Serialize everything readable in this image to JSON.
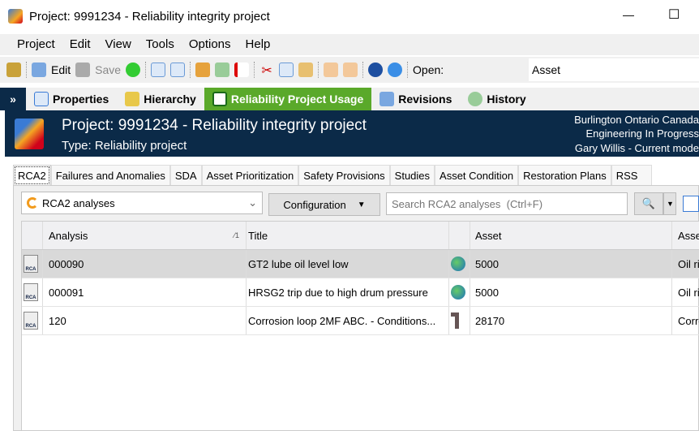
{
  "window": {
    "title": "Project: 9991234 - Reliability integrity project",
    "minimize": "—",
    "maximize": "☐"
  },
  "menu": [
    "Project",
    "Edit",
    "View",
    "Tools",
    "Options",
    "Help"
  ],
  "toolbar": {
    "edit": "Edit",
    "save": "Save",
    "open_label": "Open:",
    "open_value": "Asset"
  },
  "nav": {
    "chevron": "»",
    "items": [
      "Properties",
      "Hierarchy",
      "Reliability Project Usage",
      "Revisions",
      "History"
    ],
    "active": "Reliability Project Usage"
  },
  "header": {
    "title": "Project: 9991234 - Reliability integrity project",
    "type": "Type: Reliability  project",
    "location": "Burlington Ontario Canada",
    "status": "Engineering In Progress",
    "user": "Gary Willis - Current mode"
  },
  "tabs": [
    "RCA2",
    "Failures and Anomalies",
    "SDA",
    "Asset Prioritization",
    "Safety Provisions",
    "Studies",
    "Asset Condition",
    "Restoration Plans",
    "RSS"
  ],
  "filter": {
    "view": "RCA2 analyses",
    "configuration": "Configuration",
    "search_placeholder": "Search RCA2 analyses  (Ctrl+F)"
  },
  "grid": {
    "columns": [
      "Analysis",
      "Title",
      "Asset",
      "Asse"
    ],
    "sort_indicator": "1",
    "rows": [
      {
        "analysis": "000090",
        "title": "GT2 lube oil level low",
        "asset": "5000",
        "asset_desc": "Oil rig",
        "selected": true,
        "icon": "globe"
      },
      {
        "analysis": "000091",
        "title": "HRSG2 trip due to high drum pressure",
        "asset": "5000",
        "asset_desc": "Oil rig",
        "icon": "globe"
      },
      {
        "analysis": "120",
        "title": "Corrosion loop 2MF ABC. - Conditions...",
        "asset": "28170",
        "asset_desc": "Corro",
        "icon": "pipe"
      }
    ]
  },
  "colors": {
    "header_bg": "#0b2a48",
    "active_tab": "#5aa92a"
  }
}
